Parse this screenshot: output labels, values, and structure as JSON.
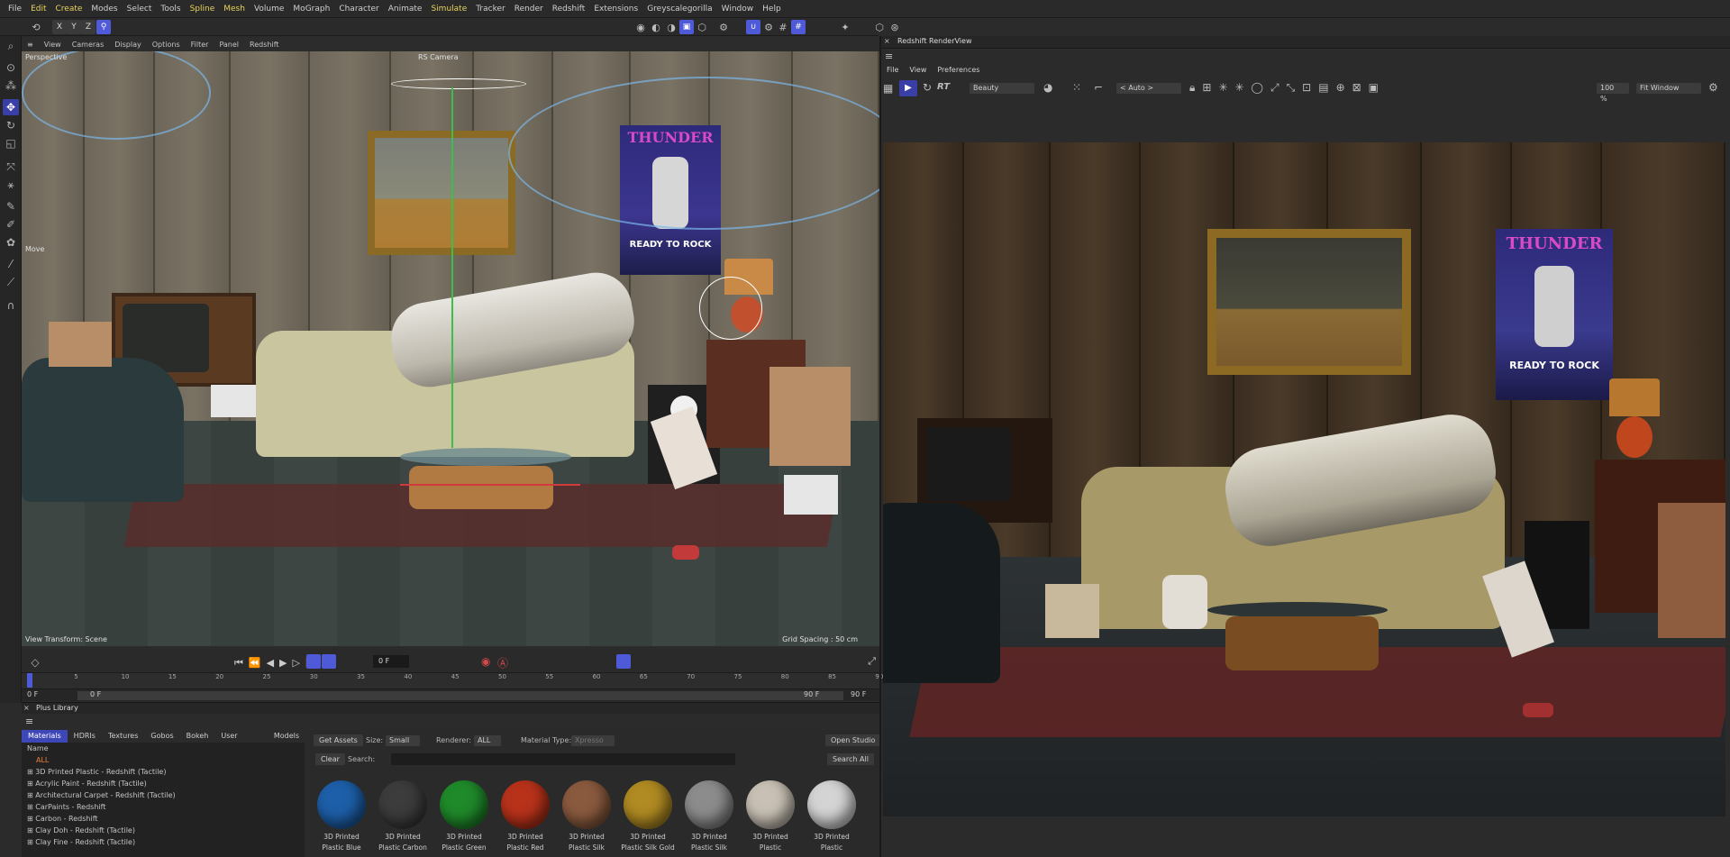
{
  "menubar": [
    "File",
    "Edit",
    "Create",
    "Modes",
    "Select",
    "Tools",
    "Spline",
    "Mesh",
    "Volume",
    "MoGraph",
    "Character",
    "Animate",
    "Simulate",
    "Tracker",
    "Render",
    "Redshift",
    "Extensions",
    "Greyscalegorilla",
    "Window",
    "Help"
  ],
  "menubar_highlighted": [
    "Edit",
    "Create",
    "Spline",
    "Mesh",
    "Simulate"
  ],
  "axis_lock": {
    "x": "X",
    "y": "Y",
    "z": "Z"
  },
  "viewport": {
    "menu": [
      "View",
      "Cameras",
      "Display",
      "Options",
      "Filter",
      "Panel",
      "Redshift"
    ],
    "projection": "Perspective",
    "camera": "RS Camera",
    "tool_label": "Move",
    "view_transform": "View Transform: Scene",
    "grid_spacing": "Grid Spacing : 50 cm",
    "poster_line1": "THUNDER",
    "poster_line2": "READY TO ROCK"
  },
  "timeline": {
    "current_frame": "0 F",
    "ticks": [
      "0",
      "5",
      "10",
      "15",
      "20",
      "25",
      "30",
      "35",
      "40",
      "45",
      "50",
      "55",
      "60",
      "65",
      "70",
      "75",
      "80",
      "85",
      "90"
    ],
    "range_start": "0 F",
    "range_start2": "0 F",
    "range_end": "90 F",
    "range_end2": "90 F"
  },
  "plus_library": {
    "title": "Plus Library",
    "tabs": [
      "Materials",
      "HDRIs",
      "Textures",
      "Gobos",
      "Bokeh",
      "User HDRIs",
      "Models"
    ],
    "active_tab": "Materials",
    "list_header": "Name",
    "list_all": "ALL",
    "list_items": [
      "3D Printed Plastic - Redshift (Tactile)",
      "Acrylic Paint - Redshift (Tactile)",
      "Architectural Carpet - Redshift (Tactile)",
      "CarPaints - Redshift",
      "Carbon - Redshift",
      "Clay Doh - Redshift (Tactile)",
      "Clay Fine - Redshift (Tactile)"
    ],
    "get_assets": "Get Assets",
    "size_label": "Size:",
    "size_value": "Small",
    "renderer_label": "Renderer:",
    "renderer_value": "ALL",
    "material_type_label": "Material Type:",
    "material_type_value": "Xpresso",
    "open_studio": "Open Studio",
    "clear": "Clear",
    "search_label": "Search:",
    "search_all": "Search All",
    "thumbnails": [
      {
        "line1": "3D Printed",
        "line2": "Plastic Blue",
        "color": "#1d5fa8"
      },
      {
        "line1": "3D Printed",
        "line2": "Plastic Carbon",
        "color": "#3c3c3c"
      },
      {
        "line1": "3D Printed",
        "line2": "Plastic Green",
        "color": "#1f8a2a"
      },
      {
        "line1": "3D Printed",
        "line2": "Plastic Red",
        "color": "#b8321a"
      },
      {
        "line1": "3D Printed",
        "line2": "Plastic Silk",
        "color": "#8a5a3e"
      },
      {
        "line1": "3D Printed",
        "line2": "Plastic Silk Gold",
        "color": "#b08a22"
      },
      {
        "line1": "3D Printed",
        "line2": "Plastic Silk",
        "color": "#8c8c8c"
      },
      {
        "line1": "3D Printed",
        "line2": "Plastic",
        "color": "#c8c0b4"
      },
      {
        "line1": "3D Printed",
        "line2": "Plastic",
        "color": "#d4d4d4"
      }
    ]
  },
  "render_view": {
    "title": "Redshift RenderView",
    "menu": [
      "File",
      "View",
      "Preferences"
    ],
    "rt_label": "RT",
    "aov": "Beauty",
    "auto": "< Auto >",
    "zoom": "100 %",
    "fit": "Fit Window",
    "poster_line1": "THUNDER",
    "poster_line2": "READY TO ROCK"
  },
  "colors": {
    "accent": "#4f5ad8",
    "menu_highlight": "#e8d35a"
  }
}
